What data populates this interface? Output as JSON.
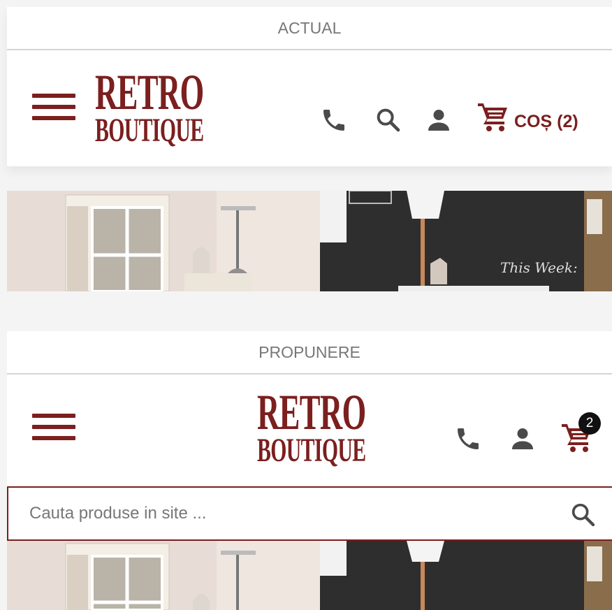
{
  "actual": {
    "label": "ACTUAL",
    "logo": {
      "line1": "RETRO",
      "line2": "BOUTIQUE"
    },
    "cart_label": "COȘ (2)"
  },
  "proposal": {
    "label": "PROPUNERE",
    "logo": {
      "line1": "RETRO",
      "line2": "BOUTIQUE"
    },
    "cart_badge": "2",
    "search_placeholder": "Cauta produse in site ..."
  },
  "banner": {
    "chalk_text": "This Week:"
  },
  "icons": [
    "hamburger-icon",
    "phone-icon",
    "search-icon",
    "user-icon",
    "cart-icon"
  ],
  "colors": {
    "brand": "#7b1f1f",
    "icon_gray": "#4a4a4a",
    "badge": "#111111"
  }
}
